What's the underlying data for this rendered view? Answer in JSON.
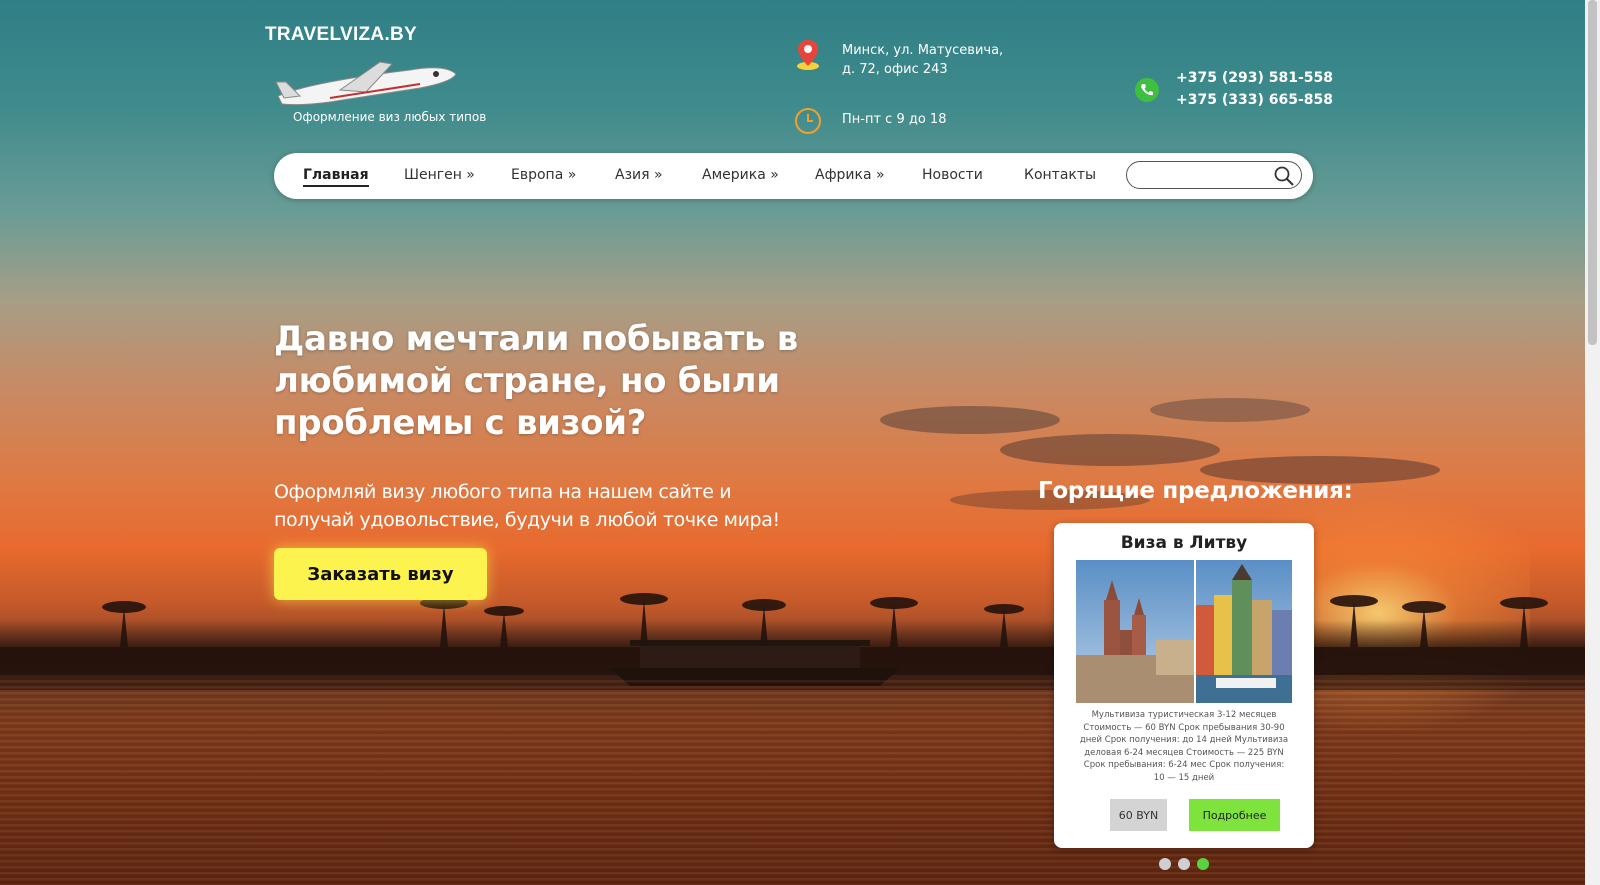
{
  "brand": {
    "name": "TRAVELVIZA.BY",
    "tagline": "Оформление виз любых типов"
  },
  "contacts": {
    "address_line1": "Минск, ул. Матусевича,",
    "address_line2": "д. 72, офис 243",
    "hours": "Пн-пт с 9 до 18",
    "phone1": "+375 (293) 581-558",
    "phone2": "+375 (333) 665-858"
  },
  "nav": {
    "items": [
      {
        "label": "Главная"
      },
      {
        "label": "Шенген »"
      },
      {
        "label": "Европа »"
      },
      {
        "label": "Азия »"
      },
      {
        "label": "Америка »"
      },
      {
        "label": "Африка »"
      },
      {
        "label": "Новости"
      },
      {
        "label": "Контакты"
      }
    ],
    "search_placeholder": ""
  },
  "hero": {
    "title": "Давно мечтали побывать в любимой стране, но были проблемы с визой?",
    "subtitle": "Оформляй визу любого типа на нашем сайте и получай удовольствие, будучи в любой точке мира!",
    "cta_label": "Заказать визу"
  },
  "offers": {
    "heading": "Горящие предложения:",
    "card": {
      "title": "Виза в Литву",
      "description": "Мультивиза туристическая 3-12 месяцев Стоимость — 60 BYN Срок пребывания 30-90 дней Срок получения: до 14 дней Мультивиза деловая 6-24 месяцев Стоимость — 225 BYN Срок пребывания: 6-24 мес Срок получения: 10 — 15 дней",
      "price_label": "60 BYN",
      "more_label": "Подробнее"
    },
    "slider_total": 3,
    "slider_active": 3
  },
  "colors": {
    "cta": "#fdf34f",
    "more_button": "#7ee33d",
    "active_dot": "#58d23d",
    "price_button": "#d4d4d4"
  }
}
